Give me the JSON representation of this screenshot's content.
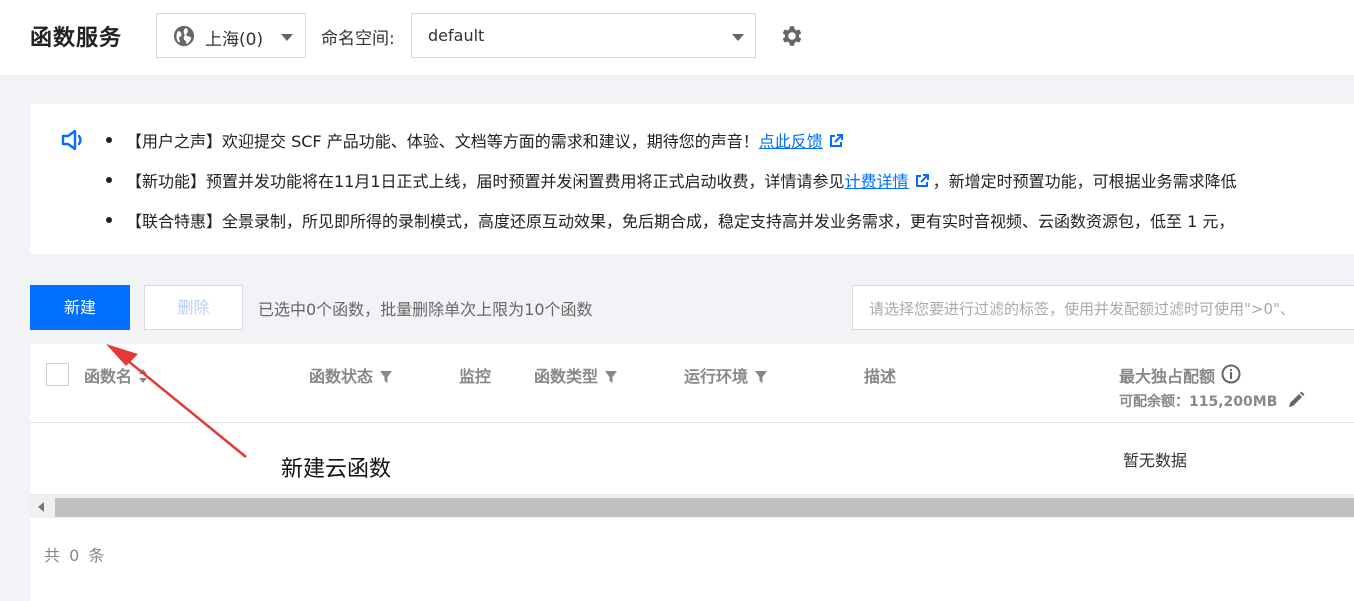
{
  "header": {
    "title": "函数服务",
    "region": {
      "value": "上海(0)",
      "icon": "globe-icon"
    },
    "namespace": {
      "label": "命名空间:",
      "value": "default"
    },
    "settings_icon": "gear-icon"
  },
  "notice": {
    "icon": "speaker-icon",
    "items": [
      {
        "text": "【用户之声】欢迎提交 SCF 产品功能、体验、文档等方面的需求和建议，期待您的声音！",
        "link": "点此反馈",
        "after": ""
      },
      {
        "text": "【新功能】预置并发功能将在11月1日正式上线，届时预置并发闲置费用将正式启动收费，详情请参见",
        "link": "计费详情",
        "after": "，新增定时预置功能，可根据业务需求降低"
      },
      {
        "text": "【联合特惠】全景录制，所见即所得的录制模式，高度还原互动效果，免后期合成，稳定支持高并发业务需求，更有实时音视频、云函数资源包，低至 1 元，",
        "link": "",
        "after": ""
      }
    ]
  },
  "toolbar": {
    "new_label": "新建",
    "delete_label": "删除",
    "selection_info": "已选中0个函数，批量删除单次上限为10个函数",
    "filter_placeholder": "请选择您要进行过滤的标签，使用并发配额过滤时可使用\">0\"、"
  },
  "table": {
    "columns": {
      "name": "函数名",
      "status": "函数状态",
      "monitor": "监控",
      "type": "函数类型",
      "runtime": "运行环境",
      "desc": "描述",
      "quota": "最大独占配额"
    },
    "quota_sub": "可配余额：115,200MB",
    "empty_text": "暂无数据",
    "total": "共 0 条"
  },
  "annotation": {
    "text": "新建云函数",
    "color": "#e53935"
  },
  "colors": {
    "primary": "#006eff",
    "page_bg": "#f2f3f7"
  }
}
